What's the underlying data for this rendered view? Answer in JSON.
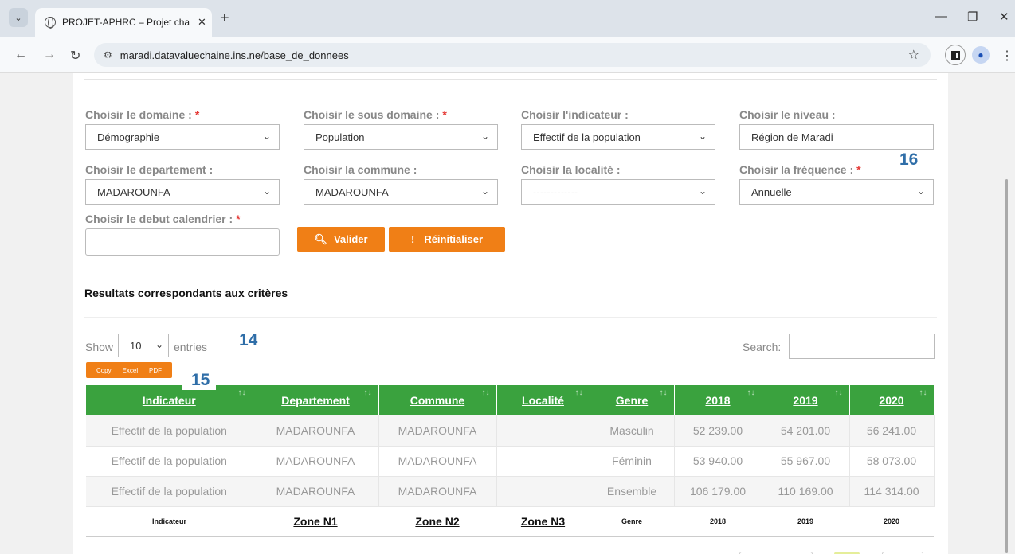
{
  "browser": {
    "tab_title": "PROJET-APHRC – Projet chaine",
    "url": "maradi.datavaluechaine.ins.ne/base_de_donnees"
  },
  "filters": {
    "domaine": {
      "label": "Choisir le domaine :",
      "value": "Démographie",
      "required": true
    },
    "sous_domaine": {
      "label": "Choisir le sous domaine :",
      "value": "Population",
      "required": true
    },
    "indicateur": {
      "label": "Choisir l'indicateur :",
      "value": "Effectif de la population",
      "required": false
    },
    "niveau": {
      "label": "Choisir le niveau :",
      "value": "Région de Maradi",
      "required": false
    },
    "departement": {
      "label": "Choisir le departement :",
      "value": "MADAROUNFA",
      "required": false
    },
    "commune": {
      "label": "Choisir la commune :",
      "value": "MADAROUNFA",
      "required": false
    },
    "localite": {
      "label": "Choisir la localité :",
      "value": "-------------",
      "required": false
    },
    "frequence": {
      "label": "Choisir la fréquence :",
      "value": "Annuelle",
      "required": true
    },
    "debut_calendrier": {
      "label": "Choisir le debut calendrier :",
      "value": "",
      "required": true
    },
    "required_mark": "*"
  },
  "actions": {
    "validate_label": "Valider",
    "reset_label": "Réinitialiser",
    "reset_glyph": "!"
  },
  "annotations": {
    "a14": "14",
    "a15": "15",
    "a16": "16"
  },
  "results": {
    "title": "Resultats correspondants aux critères",
    "show_label": "Show",
    "entries_label": "entries",
    "page_length": "10",
    "search_label": "Search:",
    "export_buttons": [
      "Copy",
      "Excel",
      "PDF"
    ],
    "headers": [
      "Indicateur",
      "Departement",
      "Commune",
      "Localité",
      "Genre",
      "2018",
      "2019",
      "2020"
    ],
    "rows": [
      [
        "Effectif de la population",
        "MADAROUNFA",
        "MADAROUNFA",
        "",
        "Masculin",
        "52 239.00",
        "54 201.00",
        "56 241.00"
      ],
      [
        "Effectif de la population",
        "MADAROUNFA",
        "MADAROUNFA",
        "",
        "Féminin",
        "53 940.00",
        "55 967.00",
        "58 073.00"
      ],
      [
        "Effectif de la population",
        "MADAROUNFA",
        "MADAROUNFA",
        "",
        "Ensemble",
        "106 179.00",
        "110 169.00",
        "114 314.00"
      ]
    ],
    "footer": [
      "Indicateur",
      "Zone N1",
      "Zone N2",
      "Zone N3",
      "Genre",
      "2018",
      "2019",
      "2020"
    ]
  },
  "colors": {
    "accent": "#f07f16",
    "table_header": "#3aa23e",
    "required": "#e53935",
    "annotation": "#2f6ea8"
  }
}
